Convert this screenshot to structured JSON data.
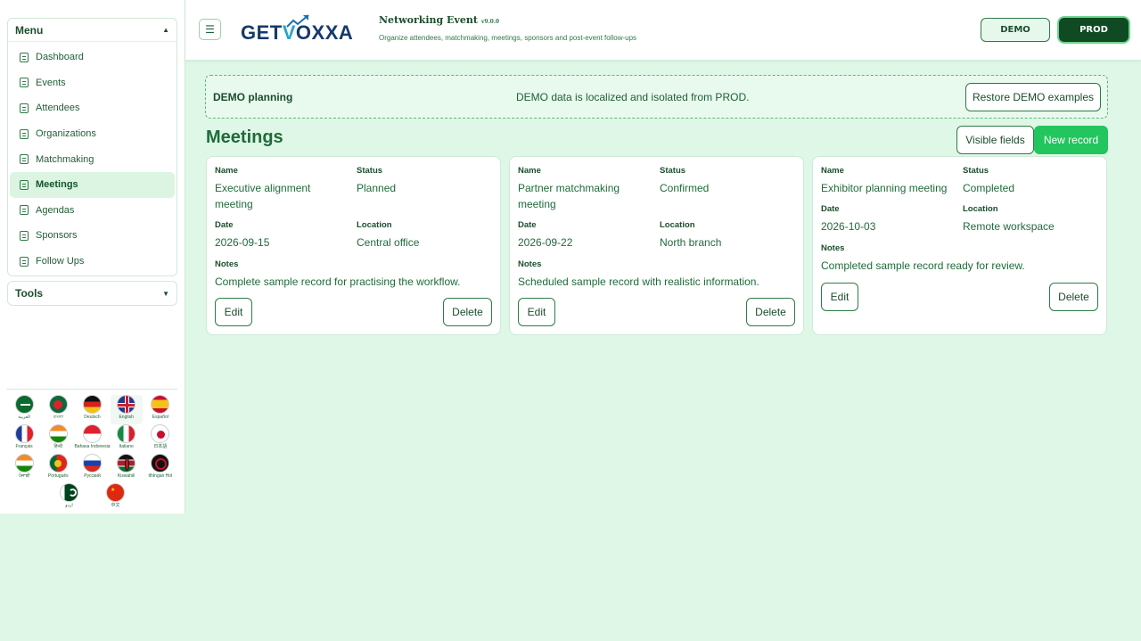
{
  "sidebar": {
    "menu_title": "Menu",
    "menu_caret": "▲",
    "items": [
      {
        "label": "Dashboard",
        "active": false
      },
      {
        "label": "Events",
        "active": false
      },
      {
        "label": "Attendees",
        "active": false
      },
      {
        "label": "Organizations",
        "active": false
      },
      {
        "label": "Matchmaking",
        "active": false
      },
      {
        "label": "Meetings",
        "active": true
      },
      {
        "label": "Agendas",
        "active": false
      },
      {
        "label": "Sponsors",
        "active": false
      },
      {
        "label": "Follow Ups",
        "active": false
      }
    ],
    "tools_title": "Tools",
    "tools_caret": "▼",
    "languages": [
      {
        "name": "العربية",
        "flag": "saudi-arabia"
      },
      {
        "name": "বাংলা",
        "flag": "bangladesh"
      },
      {
        "name": "Deutsch",
        "flag": "germany"
      },
      {
        "name": "English",
        "flag": "united-kingdom",
        "selected": true
      },
      {
        "name": "Español",
        "flag": "spain"
      },
      {
        "name": "Français",
        "flag": "france"
      },
      {
        "name": "हिन्दी",
        "flag": "india"
      },
      {
        "name": "Bahasa Indonesia",
        "flag": "indonesia"
      },
      {
        "name": "Italiano",
        "flag": "italy"
      },
      {
        "name": "日本語",
        "flag": "japan"
      },
      {
        "name": "ਪੰਜਾਬੀ",
        "flag": "india"
      },
      {
        "name": "Português",
        "flag": "portugal"
      },
      {
        "name": "Русский",
        "flag": "russia"
      },
      {
        "name": "Kiswahili",
        "flag": "kenya"
      },
      {
        "name": "tlhIngan Hol",
        "flag": "klingon"
      },
      {
        "name": "اردو",
        "flag": "pakistan"
      },
      {
        "name": "中文",
        "flag": "china"
      }
    ]
  },
  "header": {
    "logo_left": "GET",
    "logo_v": "V",
    "logo_right": "OXXA",
    "title": "Networking Event",
    "version": "v9.0.0",
    "subtitle": "Organize attendees, matchmaking, meetings, sponsors and post-event follow-ups",
    "demo_label": "DEMO",
    "prod_label": "PROD",
    "collapse_icon": "☰"
  },
  "banner": {
    "title": "DEMO planning",
    "message": "DEMO data is localized and isolated from PROD.",
    "restore_label": "Restore DEMO examples"
  },
  "page": {
    "title": "Meetings",
    "visible_fields_label": "Visible fields",
    "new_record_label": "New record"
  },
  "labels": {
    "name": "Name",
    "status": "Status",
    "date": "Date",
    "location": "Location",
    "notes": "Notes",
    "edit": "Edit",
    "delete": "Delete"
  },
  "records": [
    {
      "name": "Executive alignment meeting",
      "status": "Planned",
      "date": "2026-09-15",
      "location": "Central office",
      "notes": "Complete sample record for practising the workflow."
    },
    {
      "name": "Partner matchmaking meeting",
      "status": "Confirmed",
      "date": "2026-09-22",
      "location": "North branch",
      "notes": "Scheduled sample record with realistic information."
    },
    {
      "name": "Exhibitor planning meeting",
      "status": "Completed",
      "date": "2026-10-03",
      "location": "Remote workspace",
      "notes": "Completed sample record ready for review."
    }
  ],
  "colors": {
    "accent": "#22c55e",
    "prod": "#0f4a22",
    "background": "#dff7e6"
  }
}
